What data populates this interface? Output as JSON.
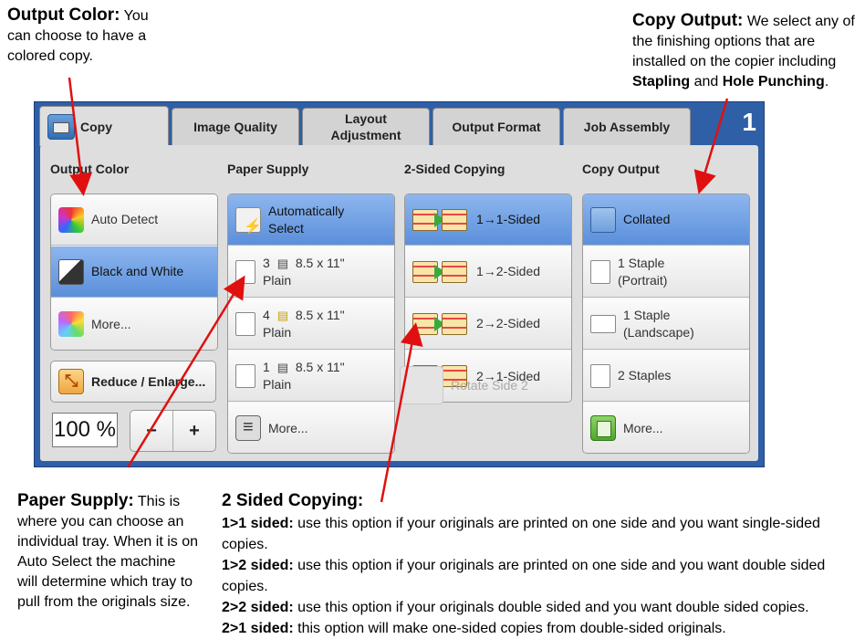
{
  "annotations": {
    "output_color": {
      "title": "Output Color:",
      "text": "You can choose to have a colored copy."
    },
    "copy_output": {
      "title": "Copy Output:",
      "text": "We select any of the finishing options that are installed on the copier including",
      "bold1": "Stapling",
      "and": "and",
      "bold2": "Hole Punching",
      "end": "."
    },
    "paper_supply": {
      "title": "Paper Supply:",
      "text": "This is where you can choose an individual tray. When it is on Auto Select the machine will determine which tray to pull from the originals size."
    },
    "two_sided": {
      "title": "2 Sided Copying:",
      "lines": [
        {
          "label": "1>1 sided:",
          "text": "use this option if your originals are printed on one side and you want single-sided copies."
        },
        {
          "label": "1>2 sided:",
          "text": "use this option if your originals are printed on one side and you want double sided copies."
        },
        {
          "label": "2>2 sided:",
          "text": "use this option if your originals double sided and you want double sided copies."
        },
        {
          "label": "2>1 sided:",
          "text": "this option will make one-sided copies from double-sided originals."
        }
      ]
    }
  },
  "screen": {
    "tabs": [
      "Copy",
      "Image Quality",
      "Layout Adjustment",
      "Output Format",
      "Job Assembly"
    ],
    "page_number": "1",
    "columns": {
      "output_color": {
        "title": "Output Color",
        "options": [
          "Auto Detect",
          "Black and White",
          "More..."
        ],
        "selected": 1
      },
      "paper_supply": {
        "title": "Paper Supply",
        "auto": "Automatically Select",
        "trays": [
          {
            "num": "3",
            "size": "8.5 x 11\"",
            "type": "Plain"
          },
          {
            "num": "4",
            "size": "8.5 x 11\"",
            "type": "Plain"
          },
          {
            "num": "1",
            "size": "8.5 x 11\"",
            "type": "Plain"
          }
        ],
        "more": "More..."
      },
      "two_sided": {
        "title": "2-Sided Copying",
        "options": [
          "1→1-Sided",
          "1→2-Sided",
          "2→2-Sided",
          "2→1-Sided"
        ],
        "rotate": "Rotate Side 2"
      },
      "copy_output": {
        "title": "Copy Output",
        "options": [
          "Collated",
          "1 Staple (Portrait)",
          "1 Staple (Landscape)",
          "2 Staples",
          "More..."
        ]
      }
    },
    "reduce_enlarge": "Reduce / Enlarge...",
    "zoom": "100 %",
    "minus": "−",
    "plus": "+"
  },
  "colors": {
    "selected": "#5b8fdb",
    "frame": "#2f5fa7",
    "arrow": "#e01010"
  }
}
